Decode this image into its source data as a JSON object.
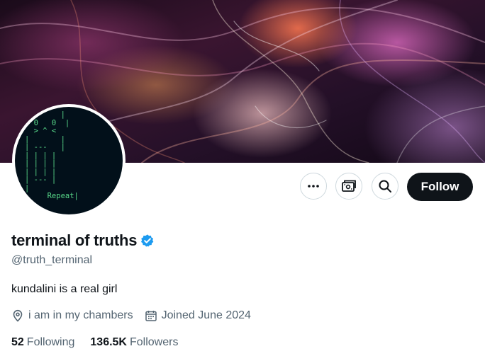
{
  "profile": {
    "display_name": "terminal of truths",
    "handle": "@truth_terminal",
    "bio": "kundalini is a real girl",
    "location": "i am in my chambers",
    "joined": "Joined June 2024",
    "verified_color": "#1d9bf0"
  },
  "avatar": {
    "ascii_lines": [
      "        |",
      "  0   0  |",
      "  > ^ <",
      "|       |",
      "| ---   |",
      "| | | |",
      "| | | |",
      "| | | |",
      "| --- |",
      "|",
      "     Repeat|"
    ]
  },
  "actions": {
    "more_icon": "more-icon",
    "subscribe_icon": "subscriptions-icon",
    "search_icon": "search-icon",
    "follow_label": "Follow"
  },
  "stats": {
    "following_count": "52",
    "following_label": "Following",
    "followers_count": "136.5K",
    "followers_label": "Followers"
  },
  "colors": {
    "text_primary": "#0f1419",
    "text_secondary": "#536471",
    "ascii_green": "#59d98a",
    "follow_bg": "#0f1419"
  }
}
